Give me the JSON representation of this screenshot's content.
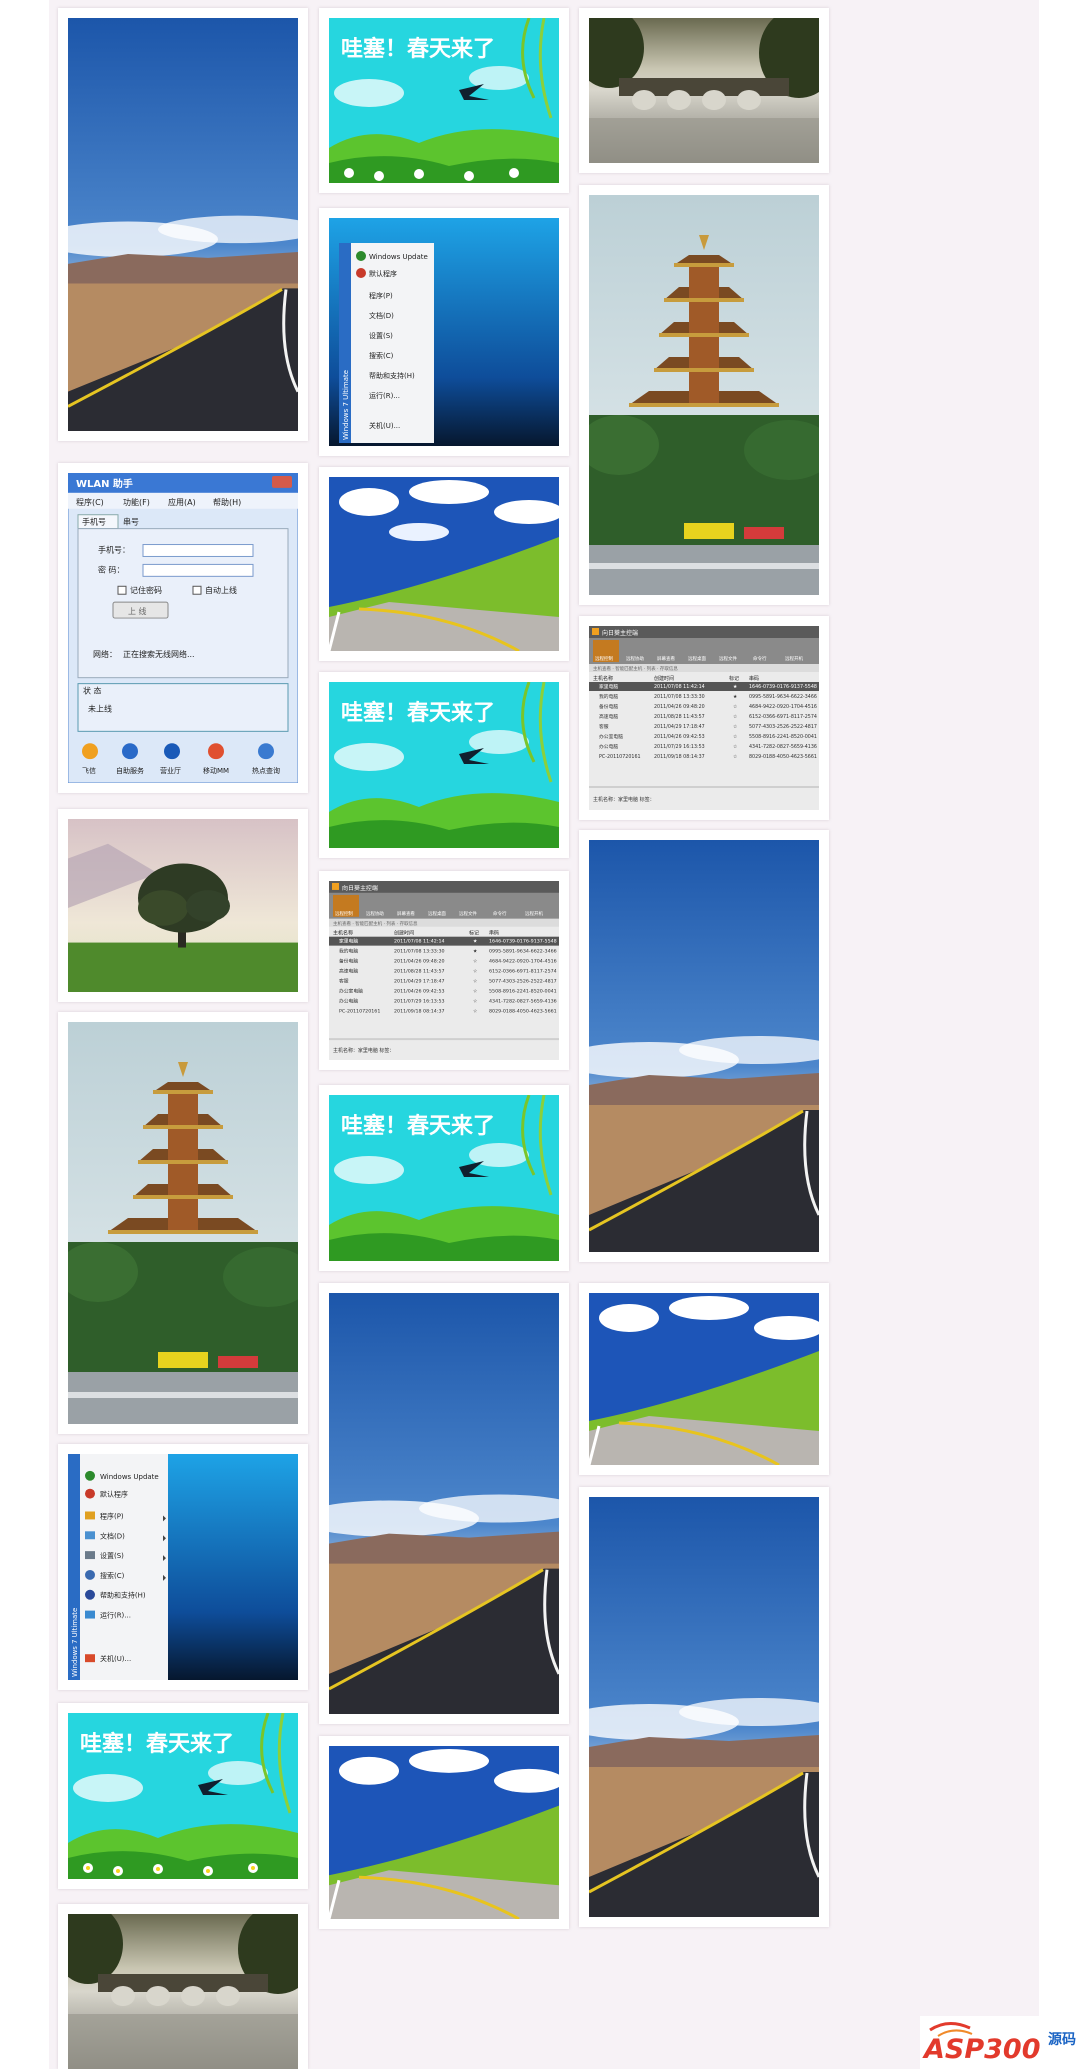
{
  "gallery": {
    "spring": {
      "headline": "哇塞！春天来了"
    },
    "start_menu": {
      "vertical_label": "Windows 7 Ultimate",
      "items": [
        "Windows Update",
        "默认程序",
        "程序(P)",
        "文档(D)",
        "设置(S)",
        "搜索(C)",
        "帮助和支持(H)",
        "运行(R)...",
        "关机(U)..."
      ]
    },
    "wlan": {
      "window_title": "WLAN 助手",
      "menu": [
        "程序(C)",
        "功能(F)",
        "应用(A)",
        "帮助(H)"
      ],
      "tabs": [
        "手机号",
        "串号"
      ],
      "phone_label": "手机号：",
      "password_label": "密  码：",
      "remember_label": "记住密码",
      "auto_login_label": "自动上线",
      "login_button": "上 线",
      "network_label": "网络：",
      "network_status": "正在搜索无线网络...",
      "status_group": "状 态",
      "status_value": "未上线",
      "shortcuts": [
        "飞信",
        "自助服务",
        "营业厅",
        "移动MM",
        "热点查询"
      ]
    },
    "remote": {
      "window_title": "向日葵主控端",
      "toolbar": [
        "远程控制",
        "远程协助",
        "屏幕查看",
        "远程桌面",
        "远程文件",
        "命令行",
        "远程开机"
      ],
      "tip": "主机查看 · 智能匹配主机 · 列表 · 存取信息",
      "columns": [
        "主机名称",
        "创建时间",
        "标记",
        "串码"
      ],
      "rows": [
        [
          "家里电脑",
          "2011/07/08 11:42:14",
          "★",
          "1646-0739-0176-9137-5548"
        ],
        [
          "我的电脑",
          "2011/07/08 13:33:30",
          "★",
          "0995-5891-9634-6622-3466"
        ],
        [
          "备份电脑",
          "2011/04/26 09:48:20",
          "☆",
          "4684-9422-0920-1704-4516"
        ],
        [
          "高速电脑",
          "2011/08/28 11:43:57",
          "☆",
          "6152-0366-6971-8117-2574"
        ],
        [
          "客服",
          "2011/04/29 17:18:47",
          "☆",
          "5077-4303-2526-2522-4817"
        ],
        [
          "办公室电脑",
          "2011/04/26 09:42:53",
          "☆",
          "5508-8916-2241-8520-0041"
        ],
        [
          "办公电脑",
          "2011/07/29 16:13:53",
          "☆",
          "4341-7282-0827-5659-4136"
        ],
        [
          "PC-20110720161",
          "2011/09/18 08:14:37",
          "☆",
          "8029-0188-4050-4623-5661"
        ]
      ],
      "footer": "主机名称：家里电脑  标签："
    },
    "logo": {
      "brand": "ASP300",
      "suffix_top": "源码",
      "suffix_bottom": ""
    }
  },
  "colors": {
    "page_bg": "#f7f2f6",
    "sky": "#1f5fb6",
    "spring_bg": "#26d6df",
    "grass": "#6cc432",
    "logo_red": "#e23a2c",
    "logo_blue": "#1b64c4"
  }
}
